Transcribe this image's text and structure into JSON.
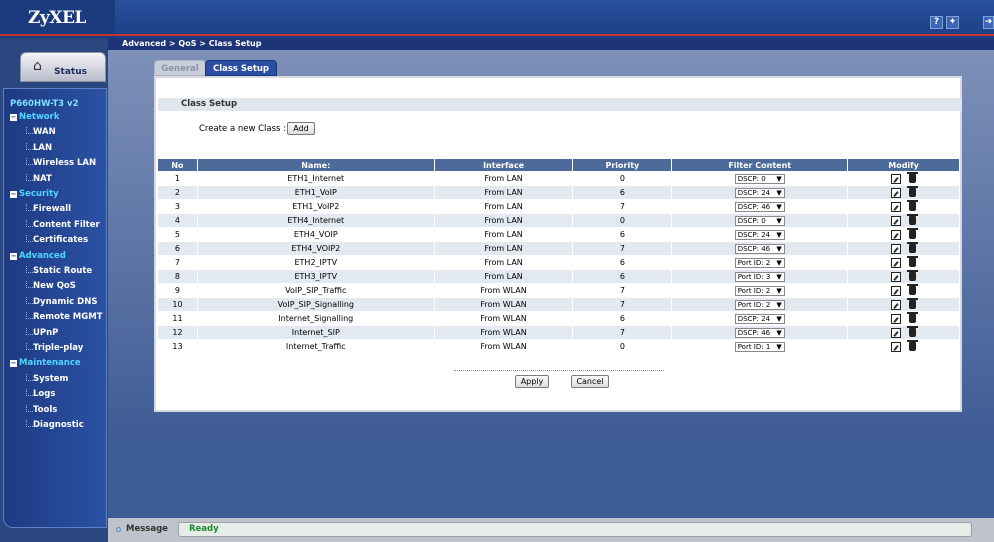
{
  "brand": "ZyXEL",
  "breadcrumb": "Advanced > QoS > Class Setup",
  "header_icons": [
    "help-icon",
    "wizard-icon",
    "logout-icon"
  ],
  "sidebar": {
    "status_label": "Status",
    "model": "P660HW-T3 v2",
    "sections": [
      {
        "label": "Network",
        "items": [
          "WAN",
          "LAN",
          "Wireless LAN",
          "NAT"
        ]
      },
      {
        "label": "Security",
        "items": [
          "Firewall",
          "Content Filter",
          "Certificates"
        ]
      },
      {
        "label": "Advanced",
        "items": [
          "Static Route",
          "New QoS",
          "Dynamic DNS",
          "Remote MGMT",
          "UPnP",
          "Triple-play"
        ]
      },
      {
        "label": "Maintenance",
        "items": [
          "System",
          "Logs",
          "Tools",
          "Diagnostic"
        ]
      }
    ]
  },
  "tabs": {
    "general": "General",
    "class_setup": "Class Setup"
  },
  "section_title": "Class Setup",
  "create_label": "Create a new Class :",
  "add_label": "Add",
  "table": {
    "headers": [
      "No",
      "Name:",
      "Interface",
      "Priority",
      "Filter Content",
      "Modify"
    ],
    "rows": [
      [
        "1",
        "ETH1_Internet",
        "From LAN",
        "0",
        "DSCP: 0"
      ],
      [
        "2",
        "ETH1_VoIP",
        "From LAN",
        "6",
        "DSCP: 24"
      ],
      [
        "3",
        "ETH1_VoIP2",
        "From LAN",
        "7",
        "DSCP: 46"
      ],
      [
        "4",
        "ETH4_Internet",
        "From LAN",
        "0",
        "DSCP: 0"
      ],
      [
        "5",
        "ETH4_VOIP",
        "From LAN",
        "6",
        "DSCP: 24"
      ],
      [
        "6",
        "ETH4_VOIP2",
        "From LAN",
        "7",
        "DSCP: 46"
      ],
      [
        "7",
        "ETH2_IPTV",
        "From LAN",
        "6",
        "Port ID: 2"
      ],
      [
        "8",
        "ETH3_IPTV",
        "From LAN",
        "6",
        "Port ID: 3"
      ],
      [
        "9",
        "VoIP_SIP_Traffic",
        "From WLAN",
        "7",
        "Port ID: 2"
      ],
      [
        "10",
        "VoIP_SIP_Signalling",
        "From WLAN",
        "7",
        "Port ID: 2"
      ],
      [
        "11",
        "Internet_Signalling",
        "From WLAN",
        "6",
        "DSCP: 24"
      ],
      [
        "12",
        "Internet_SIP",
        "From WLAN",
        "7",
        "DSCP: 46"
      ],
      [
        "13",
        "Internet_Traffic",
        "From WLAN",
        "0",
        "Port ID: 1"
      ]
    ]
  },
  "apply_label": "Apply",
  "cancel_label": "Cancel",
  "status": {
    "label": "Message",
    "value": "Ready"
  }
}
